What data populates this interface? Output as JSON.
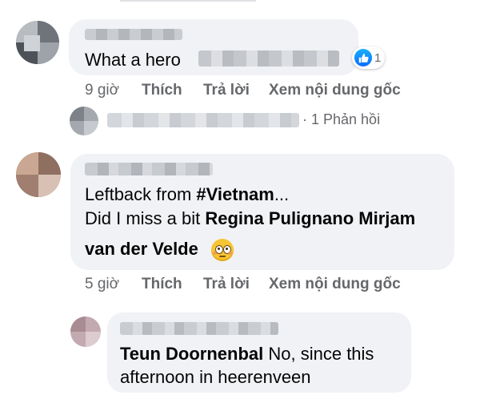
{
  "comments": [
    {
      "text": "What a hero",
      "reaction_count": "1",
      "actions": {
        "time": "9 giờ",
        "like": "Thích",
        "reply": "Trả lời",
        "see_original": "Xem nội dung gốc"
      },
      "replies_summary": "· 1 Phản hồi"
    },
    {
      "line1_prefix": "Leftback from ",
      "hashtag": "#Vietnam",
      "line1_suffix": "...",
      "line2_prefix": "Did I miss a bit ",
      "tag1": "Regina Pulignano",
      "tag2_part1": "Mirjam",
      "tag2_part2": "van der Velde",
      "emoji": "flushed-face",
      "actions": {
        "time": "5 giờ",
        "like": "Thích",
        "reply": "Trả lời",
        "see_original": "Xem nội dung gốc"
      },
      "reply": {
        "mention": "Teun Doornenbal",
        "text1": " No, since this",
        "text2": "afternoon in heerenveen"
      }
    }
  ],
  "colors": {
    "bubble": "#f0f2f5",
    "secondary_text": "#65676b",
    "like_blue": "#1877f2",
    "text": "#050505"
  }
}
